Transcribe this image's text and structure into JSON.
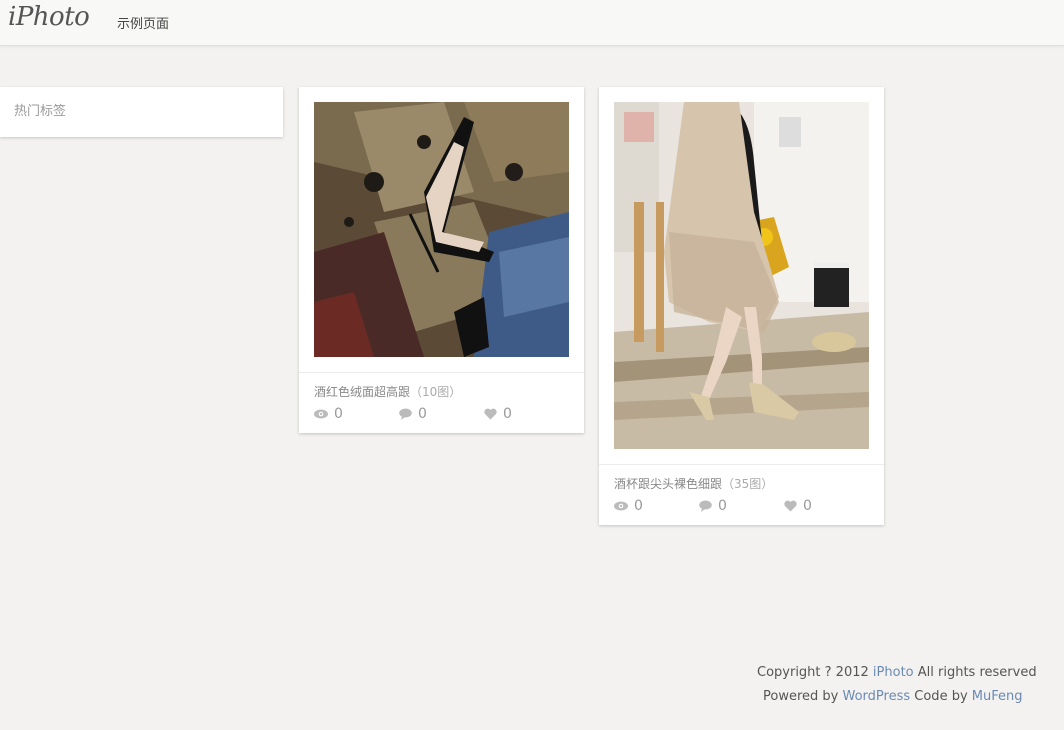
{
  "header": {
    "logo": "iPhoto",
    "nav": [
      {
        "label": "示例页面"
      }
    ]
  },
  "sidebar": {
    "title": "热门标签"
  },
  "posts": [
    {
      "title": "酒红色绒面超高跟",
      "count": "（10图）",
      "views": "0",
      "comments": "0",
      "likes": "0"
    },
    {
      "title": "酒杯跟尖头裸色细跟",
      "count": "（35图）",
      "views": "0",
      "comments": "0",
      "likes": "0"
    }
  ],
  "footer": {
    "copyright_prefix": "Copyright ? 2012",
    "site_link": "iPhoto",
    "copyright_suffix": "All rights reserved",
    "powered_prefix": "Powered by",
    "wordpress_link": "WordPress",
    "code_by": "Code by",
    "author_link": "MuFeng"
  },
  "colors": {
    "link": "#6a8ab3",
    "background": "#f3f2f0",
    "card": "#ffffff"
  }
}
